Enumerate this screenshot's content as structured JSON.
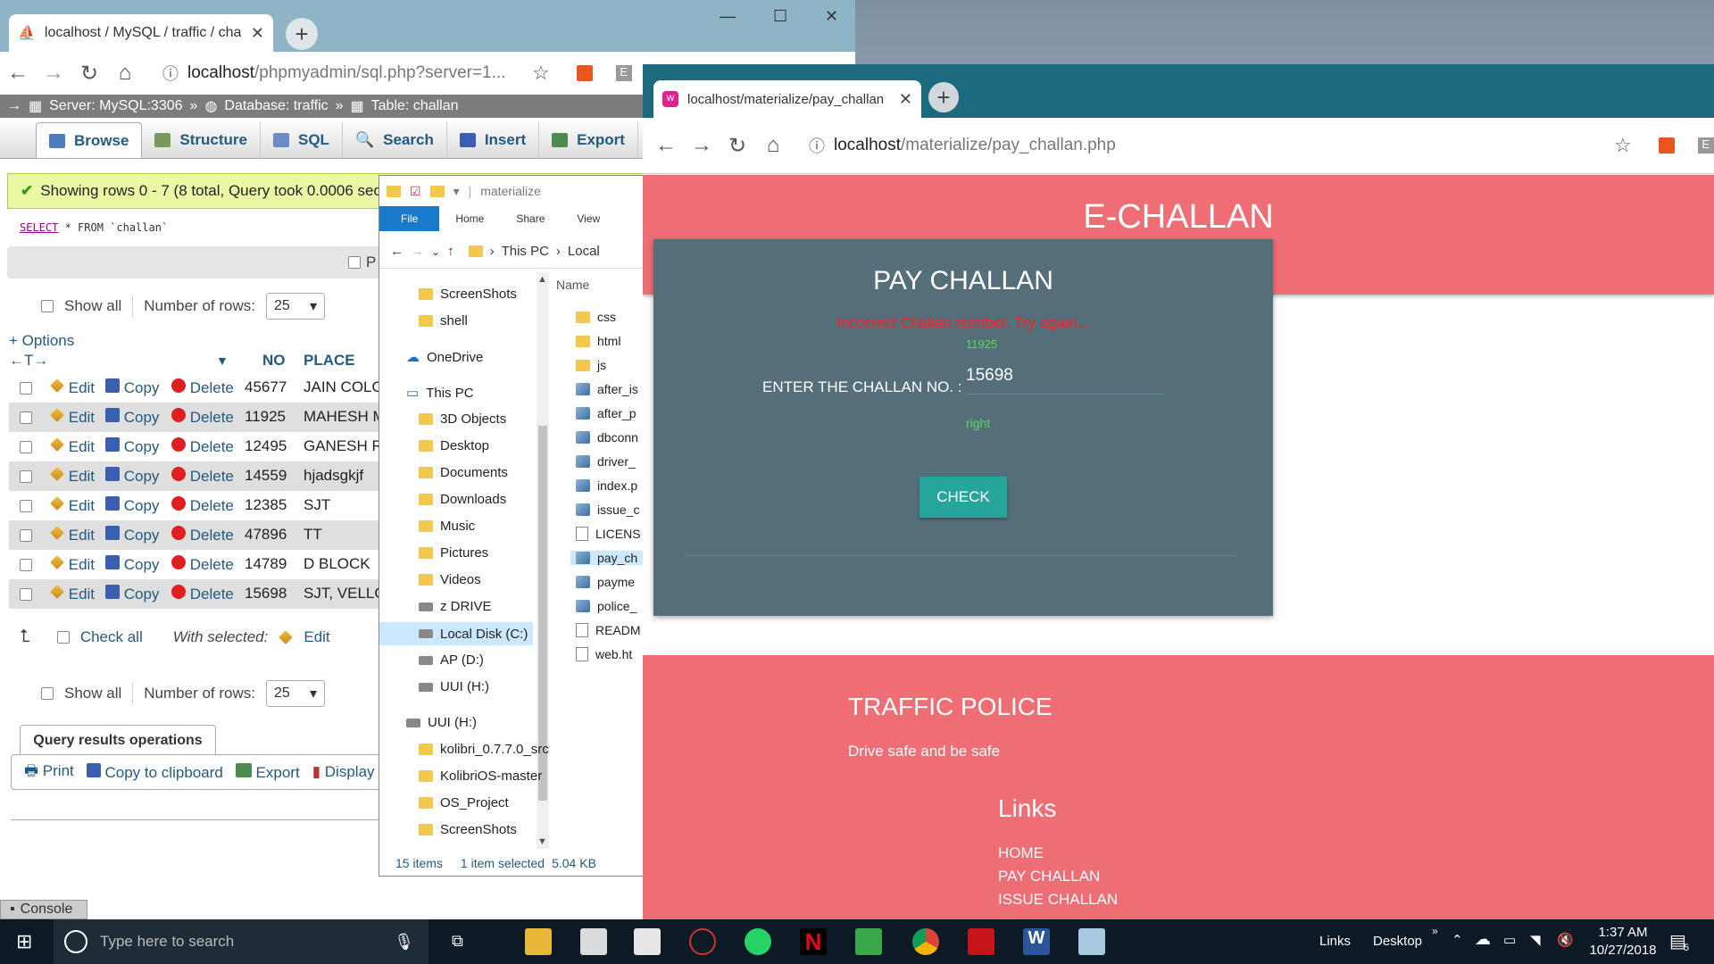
{
  "pma_window": {
    "tab_title": "localhost / MySQL / traffic / chall",
    "url_host": "localhost",
    "url_path": "/phpmyadmin/sql.php?server=1...",
    "breadcrumb": [
      "Server: MySQL:3306",
      "Database: traffic",
      "Table: challan"
    ],
    "tabs": [
      "Browse",
      "Structure",
      "SQL",
      "Search",
      "Insert",
      "Export"
    ],
    "success_msg": "Showing rows 0 - 7 (8 total, Query took 0.0006 seco",
    "sql_query": {
      "kw": "SELECT",
      "rest": " * FROM `challan`"
    },
    "profiling_label": "P",
    "show_all": "Show all",
    "rows_label": "Number of rows:",
    "rows_value": "25",
    "options_link": "+ Options",
    "columns": [
      "NO",
      "PLACE"
    ],
    "row_actions": {
      "edit": "Edit",
      "copy": "Copy",
      "delete": "Delete"
    },
    "rows": [
      {
        "no": "45677",
        "place": "JAIN COLO"
      },
      {
        "no": "11925",
        "place": "MAHESH M"
      },
      {
        "no": "12495",
        "place": "GANESH R"
      },
      {
        "no": "14559",
        "place": "hjadsgkjf"
      },
      {
        "no": "12385",
        "place": "SJT"
      },
      {
        "no": "47896",
        "place": "TT"
      },
      {
        "no": "14789",
        "place": "D BLOCK"
      },
      {
        "no": "15698",
        "place": "SJT, VELLC"
      }
    ],
    "check_all": "Check all",
    "with_selected": "With selected:",
    "with_selected_edit": "Edit",
    "qro_title": "Query results operations",
    "qro_links": [
      "Print",
      "Copy to clipboard",
      "Export",
      "Display ch"
    ],
    "console": "Console"
  },
  "explorer": {
    "title": "materialize",
    "ribbon": [
      "File",
      "Home",
      "Share",
      "View"
    ],
    "path": [
      "This PC",
      "Local"
    ],
    "nav": [
      {
        "label": "ScreenShots",
        "icon": "folder"
      },
      {
        "label": "shell",
        "icon": "folder"
      },
      {
        "label": "OneDrive",
        "icon": "onedrive"
      },
      {
        "label": "This PC",
        "icon": "pc"
      },
      {
        "label": "3D Objects",
        "icon": "folder"
      },
      {
        "label": "Desktop",
        "icon": "folder"
      },
      {
        "label": "Documents",
        "icon": "folder"
      },
      {
        "label": "Downloads",
        "icon": "folder"
      },
      {
        "label": "Music",
        "icon": "folder"
      },
      {
        "label": "Pictures",
        "icon": "folder"
      },
      {
        "label": "Videos",
        "icon": "folder"
      },
      {
        "label": "z DRIVE",
        "icon": "drive"
      },
      {
        "label": "Local Disk (C:)",
        "icon": "drive"
      },
      {
        "label": "AP (D:)",
        "icon": "drive"
      },
      {
        "label": "UUI (H:)",
        "icon": "drive"
      },
      {
        "label": "UUI (H:)",
        "icon": "drive"
      },
      {
        "label": "kolibri_0.7.7.0_src",
        "icon": "folder"
      },
      {
        "label": "KolibriOS-master",
        "icon": "folder"
      },
      {
        "label": "OS_Project",
        "icon": "folder"
      },
      {
        "label": "ScreenShots",
        "icon": "folder"
      }
    ],
    "list_header": "Name",
    "files": [
      {
        "label": "css",
        "icon": "folder"
      },
      {
        "label": "html",
        "icon": "folder"
      },
      {
        "label": "js",
        "icon": "folder"
      },
      {
        "label": "after_is",
        "icon": "php"
      },
      {
        "label": "after_p",
        "icon": "php"
      },
      {
        "label": "dbconn",
        "icon": "php"
      },
      {
        "label": "driver_",
        "icon": "php"
      },
      {
        "label": "index.p",
        "icon": "php"
      },
      {
        "label": "issue_c",
        "icon": "php"
      },
      {
        "label": "LICENS",
        "icon": "file"
      },
      {
        "label": "pay_ch",
        "icon": "php"
      },
      {
        "label": "payme",
        "icon": "php"
      },
      {
        "label": "police_",
        "icon": "php"
      },
      {
        "label": "READM",
        "icon": "file"
      },
      {
        "label": "web.ht",
        "icon": "file"
      }
    ],
    "status_items": "15 items",
    "status_selected": "1 item selected",
    "status_size": "5.04 KB"
  },
  "echallan_window": {
    "tab_title": "localhost/materialize/pay_challan",
    "url_host": "localhost",
    "url_path": "/materialize/pay_challan.php",
    "header": "E-CHALLAN",
    "card_title": "PAY CHALLAN",
    "error": "Incorrect Challan number, Try again...",
    "hint": "11925",
    "field_label": "ENTER THE CHALLAN NO. :",
    "field_value": "15698",
    "helper": "right",
    "button": "CHECK",
    "footer_title": "TRAFFIC POLICE",
    "footer_text": "Drive safe and be safe",
    "links_title": "Links",
    "links": [
      "HOME",
      "PAY CHALLAN",
      "ISSUE CHALLAN"
    ]
  },
  "taskbar": {
    "search_placeholder": "Type here to search",
    "tray_links": "Links",
    "tray_desktop": "Desktop",
    "time": "1:37 AM",
    "date": "10/27/2018",
    "notif_count": "5"
  },
  "colors": {
    "pma_accent": "#235a81",
    "echallan_header": "#ef6d74",
    "card_bg": "#546e7a",
    "button": "#26a69a",
    "error": "#ff2020"
  }
}
